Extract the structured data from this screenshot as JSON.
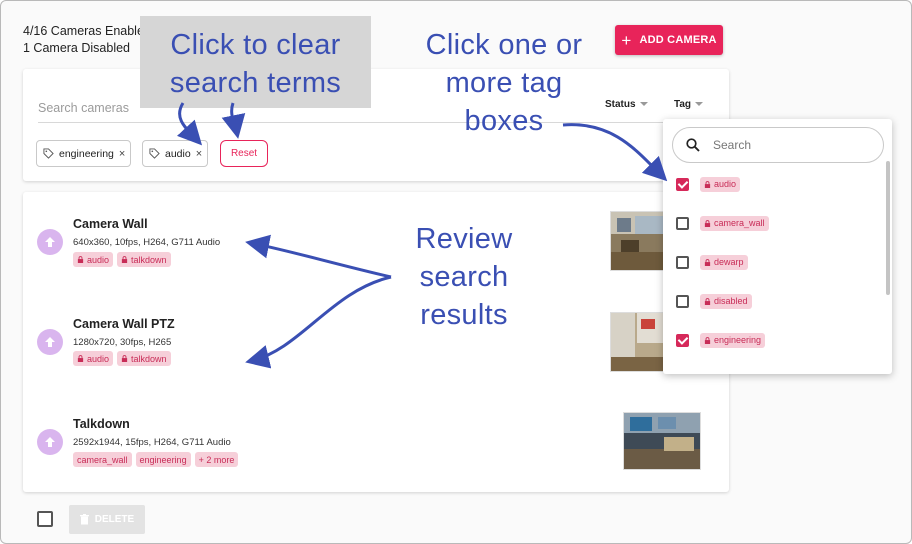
{
  "summary": {
    "enabled": "4/16 Cameras Enabled",
    "disabled": "1 Camera Disabled"
  },
  "toolbar": {
    "add_camera_label": "ADD CAMERA",
    "add_icon": "plus-icon"
  },
  "search": {
    "placeholder": "Search cameras",
    "status_col": "Status",
    "tag_col": "Tag",
    "reset_label": "Reset",
    "active_tags": [
      {
        "label": "engineering"
      },
      {
        "label": "audio"
      }
    ]
  },
  "cameras": [
    {
      "name": "Camera Wall",
      "meta": "640x360, 10fps, H264, G711 Audio",
      "tags": [
        "audio",
        "talkdown"
      ]
    },
    {
      "name": "Camera Wall PTZ",
      "meta": "1280x720, 30fps, H265",
      "tags": [
        "audio",
        "talkdown"
      ]
    },
    {
      "name": "Talkdown",
      "meta": "2592x1944, 15fps, H264, G711 Audio",
      "tags": [
        "camera_wall",
        "engineering",
        "+ 2 more"
      ]
    }
  ],
  "footer": {
    "delete_label": "DELETE"
  },
  "tag_dropdown": {
    "search_placeholder": "Search",
    "items": [
      {
        "label": "audio",
        "checked": true
      },
      {
        "label": "camera_wall",
        "checked": false
      },
      {
        "label": "dewarp",
        "checked": false
      },
      {
        "label": "disabled",
        "checked": false
      },
      {
        "label": "engineering",
        "checked": true
      }
    ]
  },
  "callouts": {
    "clear": [
      "Click to clear",
      "search terms"
    ],
    "tags": [
      "Click one or",
      "more tag",
      "boxes"
    ],
    "review": [
      "Review",
      "search",
      "results"
    ]
  },
  "colors": {
    "accent": "#e8245a",
    "tag_bg": "#f6cfd9",
    "tag_text": "#c82c57",
    "callout": "#3a4fb3",
    "avatar": "#d9b5ee"
  }
}
